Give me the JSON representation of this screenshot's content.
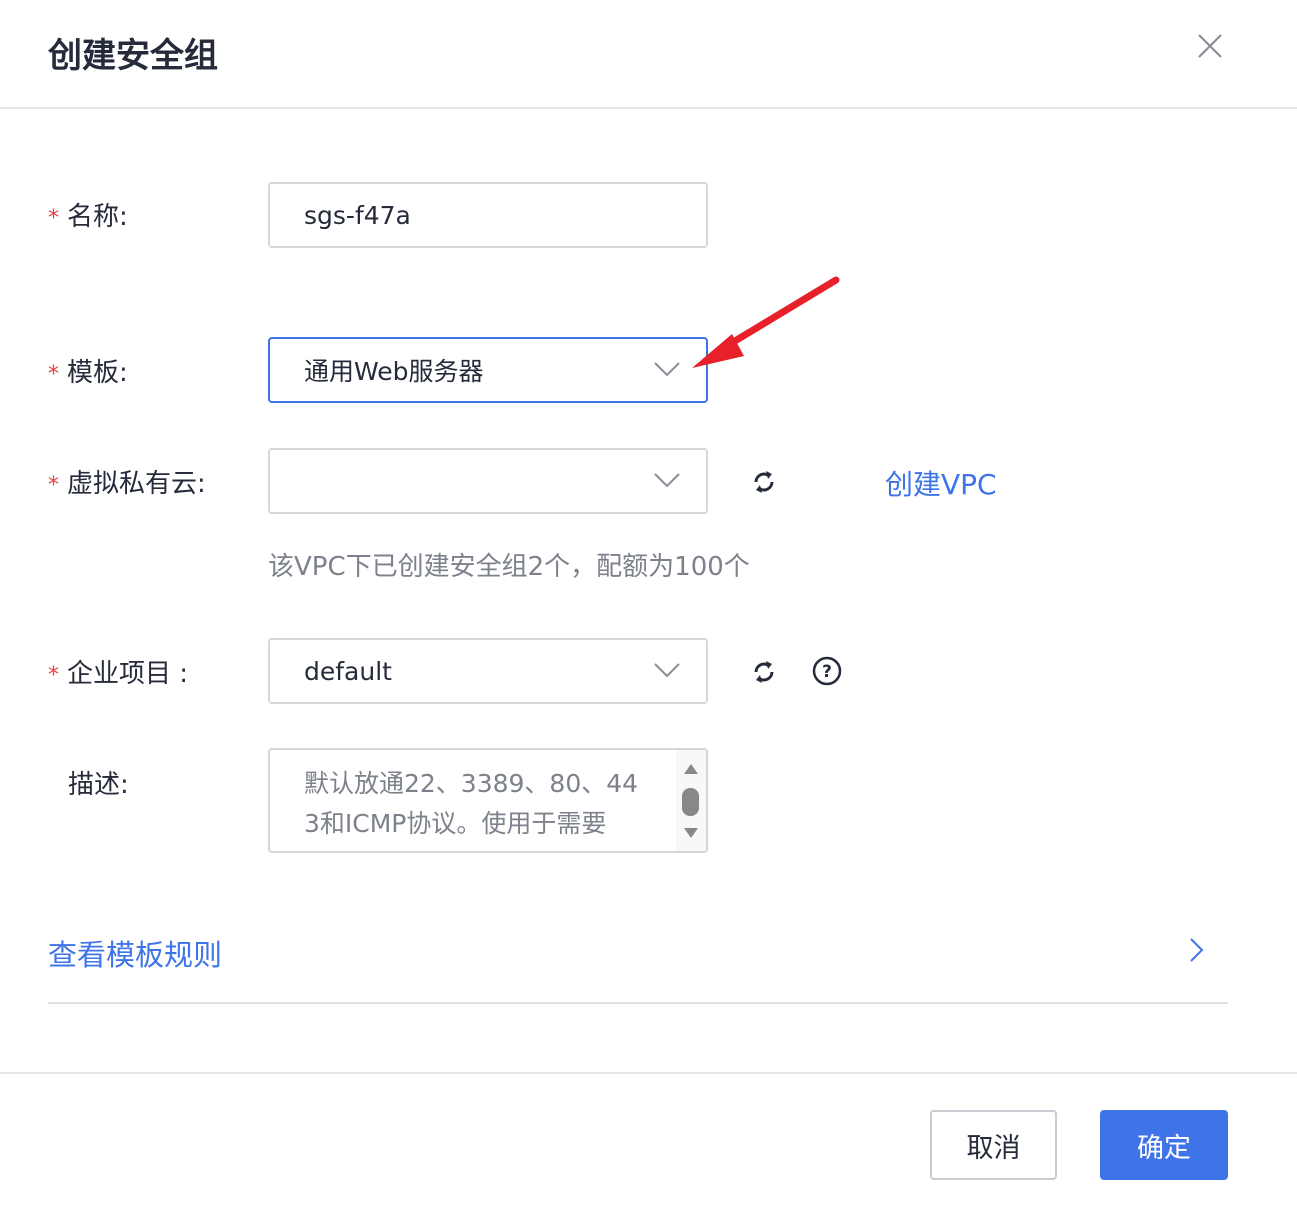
{
  "dialog": {
    "title": "创建安全组"
  },
  "form": {
    "name": {
      "label": "名称:",
      "value": "sgs-f47a"
    },
    "template": {
      "label": "模板:",
      "value": "通用Web服务器"
    },
    "vpc": {
      "label": "虚拟私有云:",
      "value": "",
      "create_link": "创建VPC",
      "hint": "该VPC下已创建安全组2个，配额为100个"
    },
    "enterprise": {
      "label": "企业项目 :",
      "value": "default"
    },
    "description": {
      "label": "描述:",
      "value_lines": [
        "默认放通22、3389、80、44",
        "3和ICMP协议。使用于需要"
      ]
    },
    "required_mark": "*"
  },
  "template_rules_link": "查看模板规则",
  "footer": {
    "cancel": "取消",
    "confirm": "确定"
  },
  "colors": {
    "primary": "#3f74e9",
    "required": "#e84040",
    "annotation_arrow": "#e8202a"
  }
}
